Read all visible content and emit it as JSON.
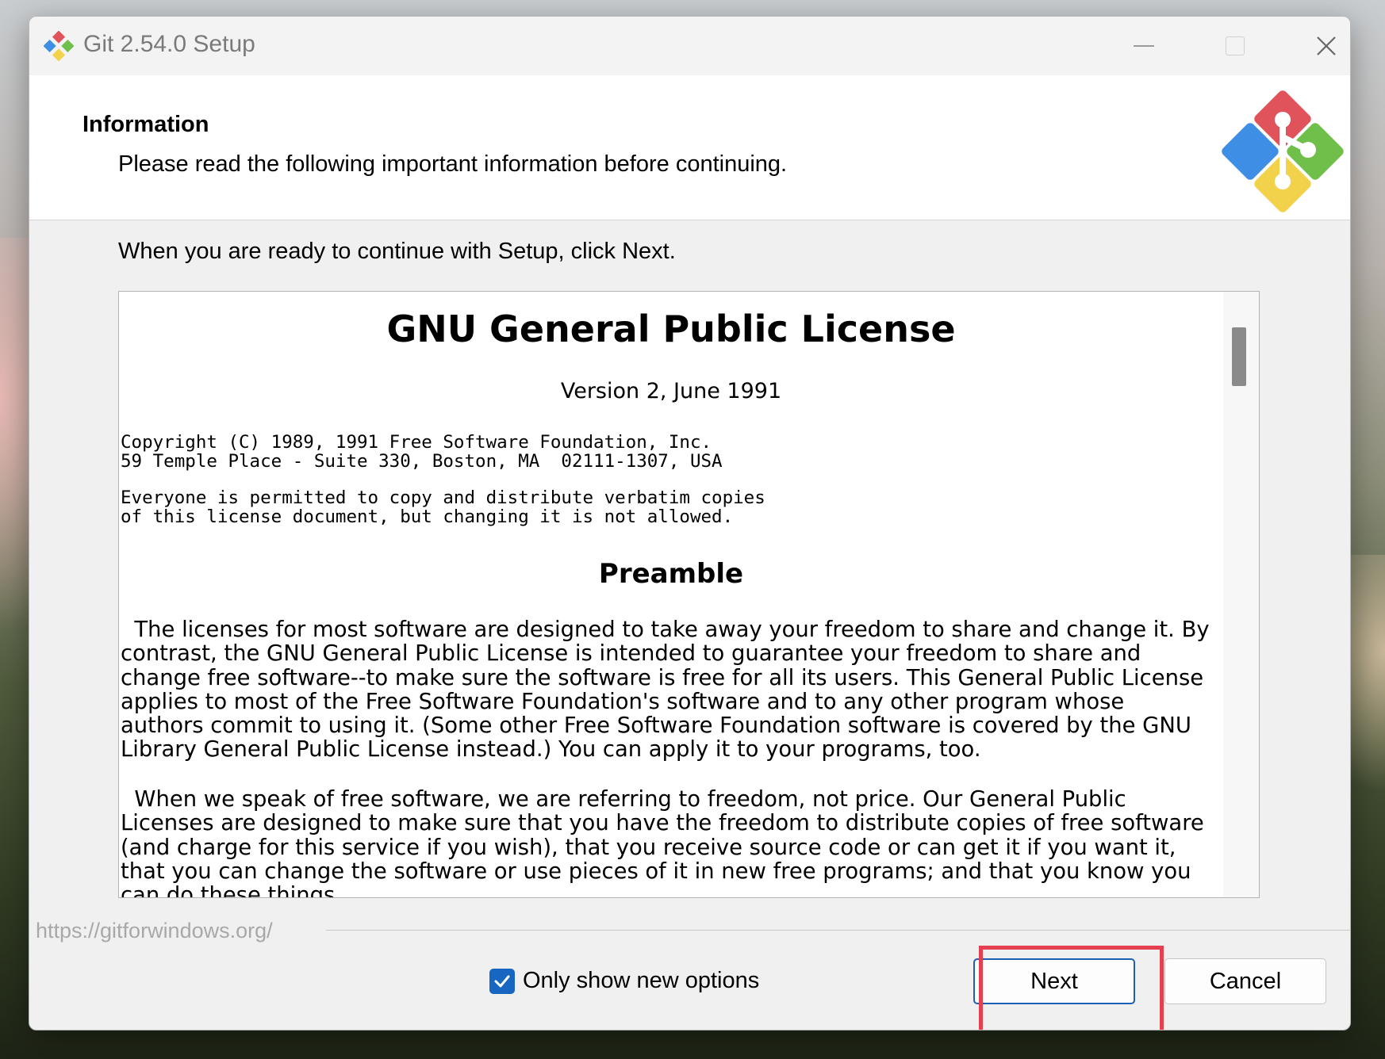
{
  "window": {
    "title": "Git 2.54.0 Setup",
    "controls": {
      "minimize": "minimize-icon",
      "maximize": "maximize-icon",
      "close": "close-icon"
    }
  },
  "header": {
    "title": "Information",
    "subtitle": "Please read the following important information before continuing."
  },
  "instructions": "When you are ready to continue with Setup, click Next.",
  "document": {
    "title": "GNU General Public License",
    "version": "Version 2, June 1991",
    "copyright_lines": "Copyright (C) 1989, 1991 Free Software Foundation, Inc.\n59 Temple Place - Suite 330, Boston, MA  02111-1307, USA",
    "permission_lines": "Everyone is permitted to copy and distribute verbatim copies\nof this license document, but changing it is not allowed.",
    "section_heading": "Preamble",
    "paragraph1": "  The licenses for most software are designed to take away your freedom to share and change it. By\ncontrast, the GNU General Public License is intended to guarantee your freedom to share and\nchange free software--to make sure the software is free for all its users. This General Public License\napplies to most of the Free Software Foundation's software and to any other program whose\nauthors commit to using it. (Some other Free Software Foundation software is covered by the GNU\nLibrary General Public License instead.) You can apply it to your programs, too.",
    "paragraph2": "  When we speak of free software, we are referring to freedom, not price. Our General Public\nLicenses are designed to make sure that you have the freedom to distribute copies of free software\n(and charge for this service if you wish), that you receive source code or can get it if you want it,\nthat you can change the software or use pieces of it in new free programs; and that you know you\ncan do these things."
  },
  "footer": {
    "link": "https://gitforwindows.org/",
    "checkbox_label": "Only show new options",
    "checkbox_checked": true,
    "next_label": "Next",
    "cancel_label": "Cancel"
  },
  "colors": {
    "accent": "#1767c2",
    "highlight": "#e5404f"
  }
}
